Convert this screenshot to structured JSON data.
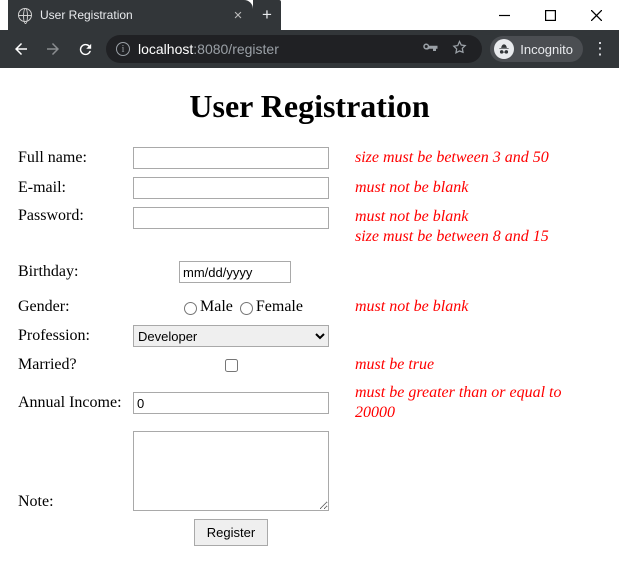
{
  "browser": {
    "tab_title": "User Registration",
    "url_host": "localhost",
    "url_port_path": ":8080/register",
    "incognito_label": "Incognito"
  },
  "page": {
    "heading": "User Registration",
    "labels": {
      "fullname": "Full name:",
      "email": "E-mail:",
      "password": "Password:",
      "birthday": "Birthday:",
      "gender": "Gender:",
      "profession": "Profession:",
      "married": "Married?",
      "income": "Annual Income:",
      "note": "Note:"
    },
    "values": {
      "fullname": "",
      "email": "",
      "password": "",
      "birthday_placeholder": "mm/dd/yyyy",
      "gender_male": "Male",
      "gender_female": "Female",
      "profession_selected": "Developer",
      "married_checked": false,
      "income": "0",
      "note": ""
    },
    "errors": {
      "fullname": "size must be between 3 and 50",
      "email": "must not be blank",
      "password": "must not be blank\nsize must be between 8 and 15",
      "gender": "must not be blank",
      "married": "must be true",
      "income": "must be greater than or equal to 20000"
    },
    "submit_label": "Register"
  }
}
